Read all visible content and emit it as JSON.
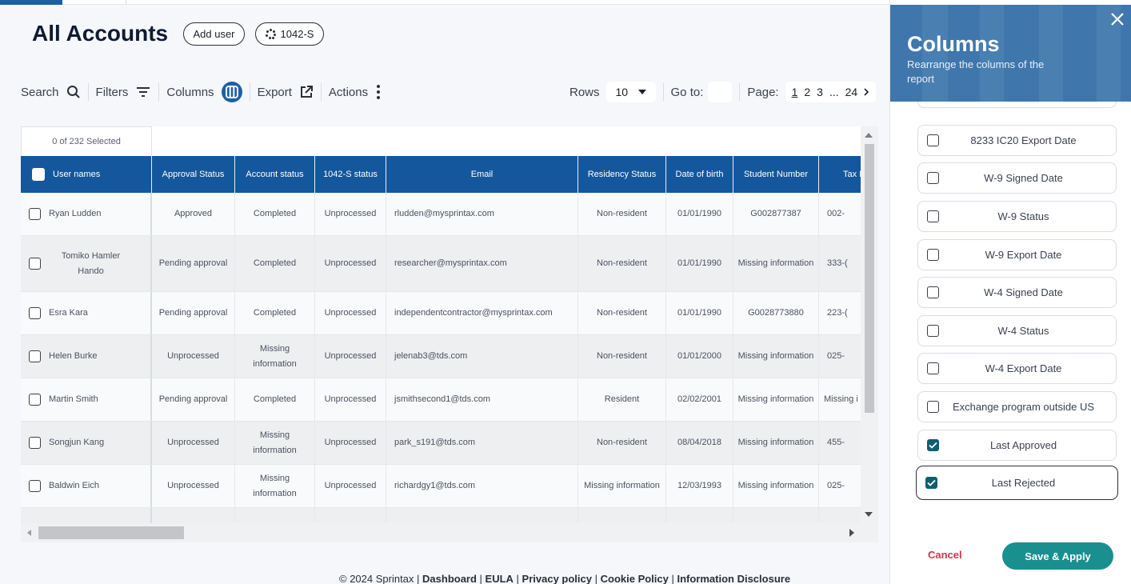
{
  "page": {
    "title": "All Accounts"
  },
  "header": {
    "add_user_label": "Add user",
    "form_1042_label": "1042-S"
  },
  "toolbar": {
    "search_label": "Search",
    "filters_label": "Filters",
    "columns_label": "Columns",
    "export_label": "Export",
    "actions_label": "Actions"
  },
  "pagination": {
    "rows_label": "Rows",
    "rows_value": "10",
    "goto_label": "Go to:",
    "page_label": "Page:",
    "pages": [
      "1",
      "2",
      "3",
      "...",
      "24"
    ]
  },
  "table": {
    "selected_count": "0 of 232 Selected",
    "columns": [
      "User names",
      "Approval Status",
      "Account status",
      "1042-S status",
      "Email",
      "Residency Status",
      "Date of birth",
      "Student Number",
      "Tax I"
    ],
    "rows": [
      {
        "name": "Ryan Ludden",
        "approval": "Approved",
        "account": "Completed",
        "status1042": "Unprocessed",
        "email": "rludden@mysprintax.com",
        "residency": "Non-resident",
        "dob": "01/01/1990",
        "student": "G002877387",
        "tax": "002-"
      },
      {
        "name": "Tomiko Hamler Hando",
        "approval": "Pending approval",
        "account": "Completed",
        "status1042": "Unprocessed",
        "email": "researcher@mysprintax.com",
        "residency": "Non-resident",
        "dob": "01/01/1990",
        "student": "Missing information",
        "tax": "333-("
      },
      {
        "name": "Esra Kara",
        "approval": "Pending approval",
        "account": "Completed",
        "status1042": "Unprocessed",
        "email": "independentcontractor@mysprintax.com",
        "residency": "Non-resident",
        "dob": "01/01/1990",
        "student": "G0028773880",
        "tax": "223-("
      },
      {
        "name": "Helen Burke",
        "approval": "Unprocessed",
        "account": "Missing information",
        "status1042": "Unprocessed",
        "email": "jelenab3@tds.com",
        "residency": "Non-resident",
        "dob": "01/01/2000",
        "student": "Missing information",
        "tax": "025-"
      },
      {
        "name": "Martin Smith",
        "approval": "Pending approval",
        "account": "Completed",
        "status1042": "Unprocessed",
        "email": "jsmithsecond1@tds.com",
        "residency": "Resident",
        "dob": "02/02/2001",
        "student": "Missing information",
        "tax": "Missing i"
      },
      {
        "name": "Songjun Kang",
        "approval": "Unprocessed",
        "account": "Missing information",
        "status1042": "Unprocessed",
        "email": "park_s191@tds.com",
        "residency": "Non-resident",
        "dob": "08/04/2018",
        "student": "Missing information",
        "tax": "455-"
      },
      {
        "name": "Baldwin Eich",
        "approval": "Unprocessed",
        "account": "Missing information",
        "status1042": "Unprocessed",
        "email": "richardgy1@tds.com",
        "residency": "Missing information",
        "dob": "12/03/1993",
        "student": "Missing information",
        "tax": "025-"
      }
    ]
  },
  "footer": {
    "copyright": "© 2024 Sprintax |",
    "links": [
      "Dashboard",
      "EULA",
      "Privacy policy",
      "Cookie Policy",
      "Information Disclosure"
    ]
  },
  "panel": {
    "title": "Columns",
    "subtitle": "Rearrange the columns of the report",
    "items": [
      {
        "label": "8233 IC20 Export Date",
        "checked": false
      },
      {
        "label": "W-9 Signed Date",
        "checked": false
      },
      {
        "label": "W-9 Status",
        "checked": false
      },
      {
        "label": "W-9 Export Date",
        "checked": false
      },
      {
        "label": "W-4 Signed Date",
        "checked": false
      },
      {
        "label": "W-4 Status",
        "checked": false
      },
      {
        "label": "W-4 Export Date",
        "checked": false
      },
      {
        "label": "Exchange program outside US",
        "checked": false
      },
      {
        "label": "Last Approved",
        "checked": true
      },
      {
        "label": "Last Rejected",
        "checked": true
      }
    ],
    "cancel_label": "Cancel",
    "apply_label": "Save & Apply"
  },
  "colors": {
    "header_blue": "#15579c",
    "panel_blue": "#3f77ad",
    "apply_teal": "#1a8f90",
    "cancel_red": "#d2314e",
    "checked_teal": "#0f5f6e"
  },
  "icons": [
    "search-icon",
    "filter-icon",
    "columns-icon",
    "export-icon",
    "kebab-icon",
    "chevron-down-icon",
    "chevron-right-icon",
    "close-icon",
    "spinner-icon",
    "check-icon"
  ]
}
